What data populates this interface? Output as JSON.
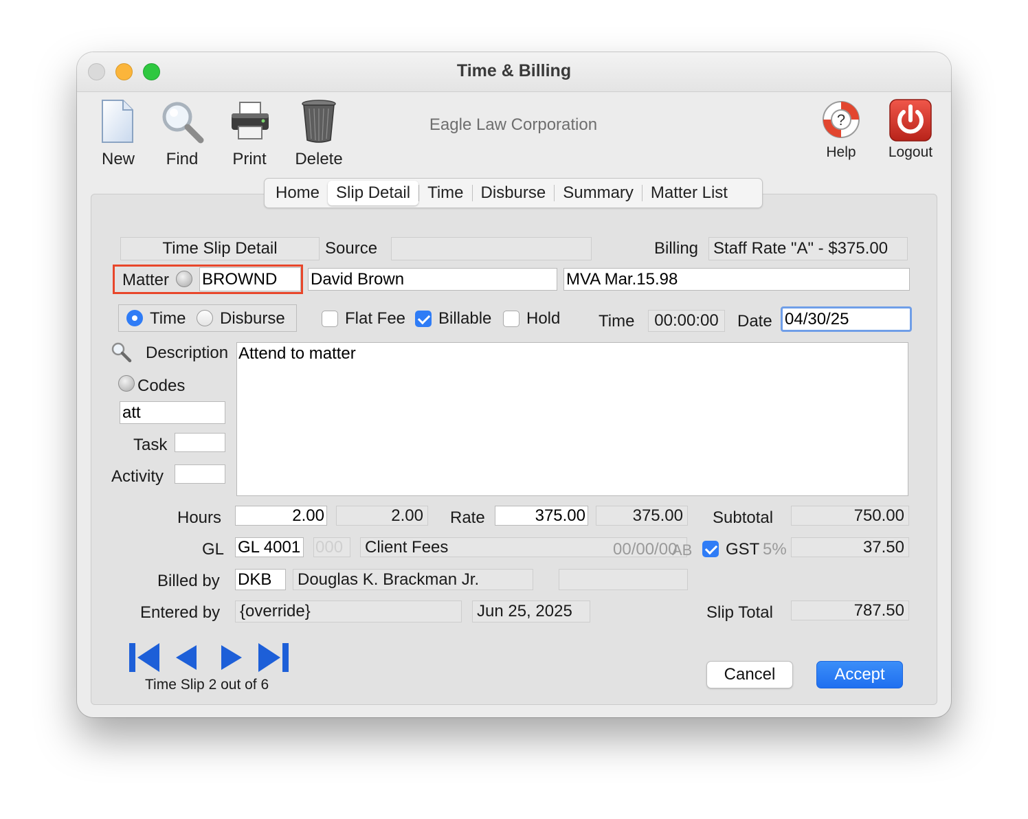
{
  "window": {
    "title": "Time & Billing",
    "company": "Eagle Law Corporation"
  },
  "toolbar": {
    "new_label": "New",
    "find_label": "Find",
    "print_label": "Print",
    "delete_label": "Delete",
    "help_label": "Help",
    "logout_label": "Logout"
  },
  "tabs": [
    {
      "label": "Home",
      "selected": false
    },
    {
      "label": "Slip Detail",
      "selected": true
    },
    {
      "label": "Time",
      "selected": false
    },
    {
      "label": "Disburse",
      "selected": false
    },
    {
      "label": "Summary",
      "selected": false
    },
    {
      "label": "Matter List",
      "selected": false
    }
  ],
  "form": {
    "section_label": "Time Slip Detail",
    "source_label": "Source",
    "source_value": "",
    "billing_label": "Billing",
    "billing_value": "Staff Rate \"A\" - $375.00",
    "matter_label": "Matter",
    "matter_value": "BROWND",
    "client_name": "David Brown",
    "matter_desc": "MVA Mar.15.98",
    "type_time_label": "Time",
    "type_disburse_label": "Disburse",
    "flat_fee_label": "Flat Fee",
    "billable_label": "Billable",
    "hold_label": "Hold",
    "time_label": "Time",
    "time_value": "00:00:00",
    "date_label": "Date",
    "date_value": "04/30/25",
    "description_label": "Description",
    "description_value": "Attend to matter",
    "codes_label": "Codes",
    "codes_value": "att",
    "task_label": "Task",
    "task_value": "",
    "activity_label": "Activity",
    "activity_value": "",
    "hours_label": "Hours",
    "hours_value": "2.00",
    "hours_billed": "2.00",
    "rate_label": "Rate",
    "rate_value": "375.00",
    "rate_billed": "375.00",
    "subtotal_label": "Subtotal",
    "subtotal_value": "750.00",
    "gl_label": "GL",
    "gl_value": "GL 4001",
    "gl_sub_placeholder": "000",
    "gl_name": "Client Fees",
    "gl_date_placeholder": "00/00/00",
    "gl_flag": "AB",
    "gst_label": "GST",
    "gst_rate": "5%",
    "gst_value": "37.50",
    "billed_by_label": "Billed by",
    "billed_by_code": "DKB",
    "billed_by_name": "Douglas K. Brackman Jr.",
    "billed_by_extra": "",
    "entered_by_label": "Entered by",
    "entered_by_value": "{override}",
    "entered_date": "Jun 25, 2025",
    "slip_total_label": "Slip Total",
    "slip_total_value": "787.50"
  },
  "nav": {
    "status": "Time Slip 2 out of 6"
  },
  "buttons": {
    "cancel_label": "Cancel",
    "accept_label": "Accept"
  },
  "colors": {
    "accent": "#2f7cf6",
    "matter_highlight": "#e8462a",
    "nav_arrow": "#1d5fd8"
  }
}
